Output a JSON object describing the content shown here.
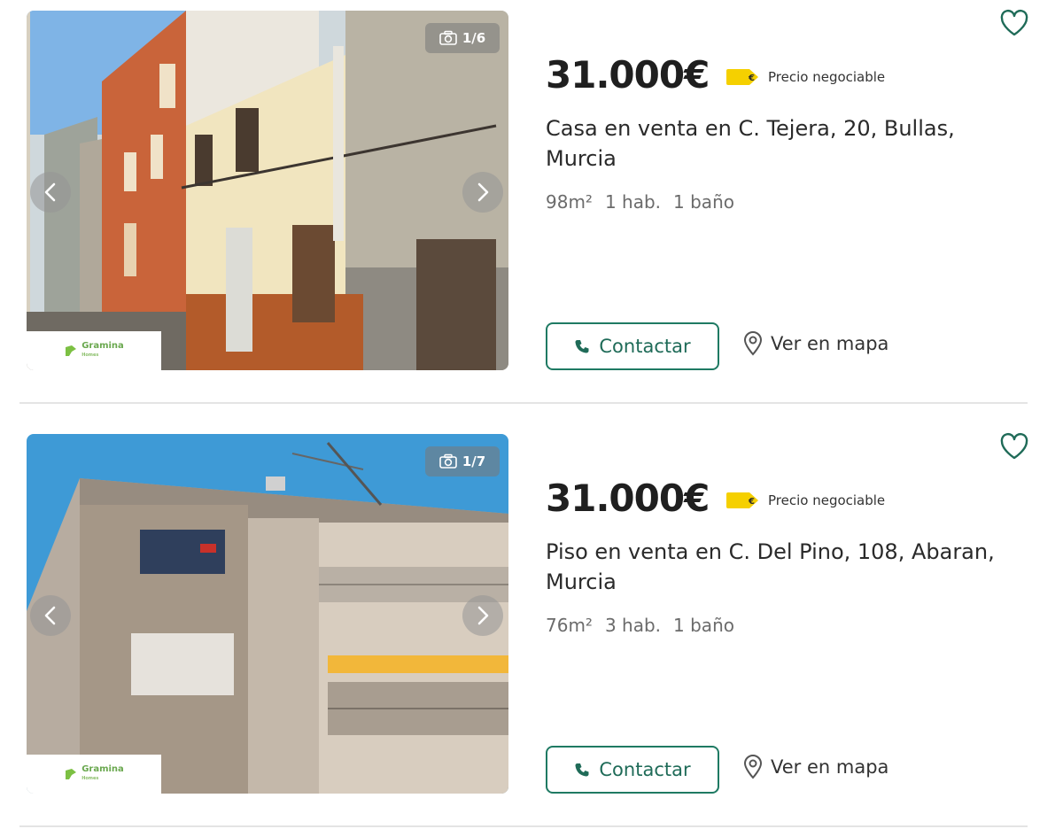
{
  "listings": [
    {
      "price": "31.000€",
      "negotiable_label": "Precio negociable",
      "title": "Casa en venta en C. Tejera, 20, Bullas, Murcia",
      "area": "98m²",
      "rooms": "1 hab.",
      "baths": "1 baño",
      "photo_counter": "1/6",
      "contact_label": "Contactar",
      "map_label": "Ver en mapa",
      "agency_name": "Gramina",
      "agency_sub": "Homes"
    },
    {
      "price": "31.000€",
      "negotiable_label": "Precio negociable",
      "title": "Piso en venta en C. Del Pino, 108, Abaran, Murcia",
      "area": "76m²",
      "rooms": "3 hab.",
      "baths": "1 baño",
      "photo_counter": "1/7",
      "contact_label": "Contactar",
      "map_label": "Ver en mapa",
      "agency_name": "Gramina",
      "agency_sub": "Homes"
    }
  ],
  "icons": {
    "camera": "camera-icon",
    "phone": "phone-icon",
    "map_pin": "map-pin-icon",
    "heart": "heart-icon",
    "tag": "price-tag-icon",
    "prev": "chevron-left-icon",
    "next": "chevron-right-icon"
  },
  "colors": {
    "accent": "#1f7a63",
    "tag_yellow": "#f5d000",
    "divider": "#e4e4e4"
  }
}
